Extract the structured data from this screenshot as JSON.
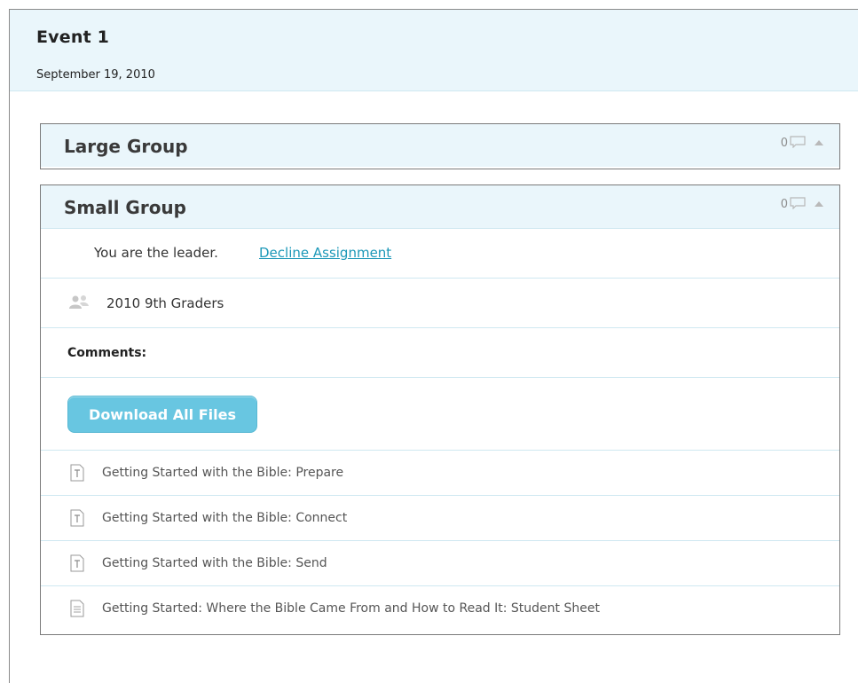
{
  "event": {
    "title": "Event 1",
    "date": "September 19, 2010"
  },
  "large_group": {
    "title": "Large Group",
    "comment_count": "0"
  },
  "small_group": {
    "title": "Small Group",
    "comment_count": "0",
    "leader_text": "You are the leader.",
    "decline_label": "Decline Assignment",
    "group_name": "2010 9th Graders",
    "comments_label": "Comments:",
    "download_label": "Download All Files",
    "files": [
      {
        "label": "Getting Started with the Bible: Prepare",
        "icon": "text-file-icon"
      },
      {
        "label": "Getting Started with the Bible: Connect",
        "icon": "text-file-icon"
      },
      {
        "label": "Getting Started with the Bible: Send",
        "icon": "text-file-icon"
      },
      {
        "label": "Getting Started: Where the Bible Came From and How to Read It: Student Sheet",
        "icon": "document-icon"
      }
    ]
  }
}
